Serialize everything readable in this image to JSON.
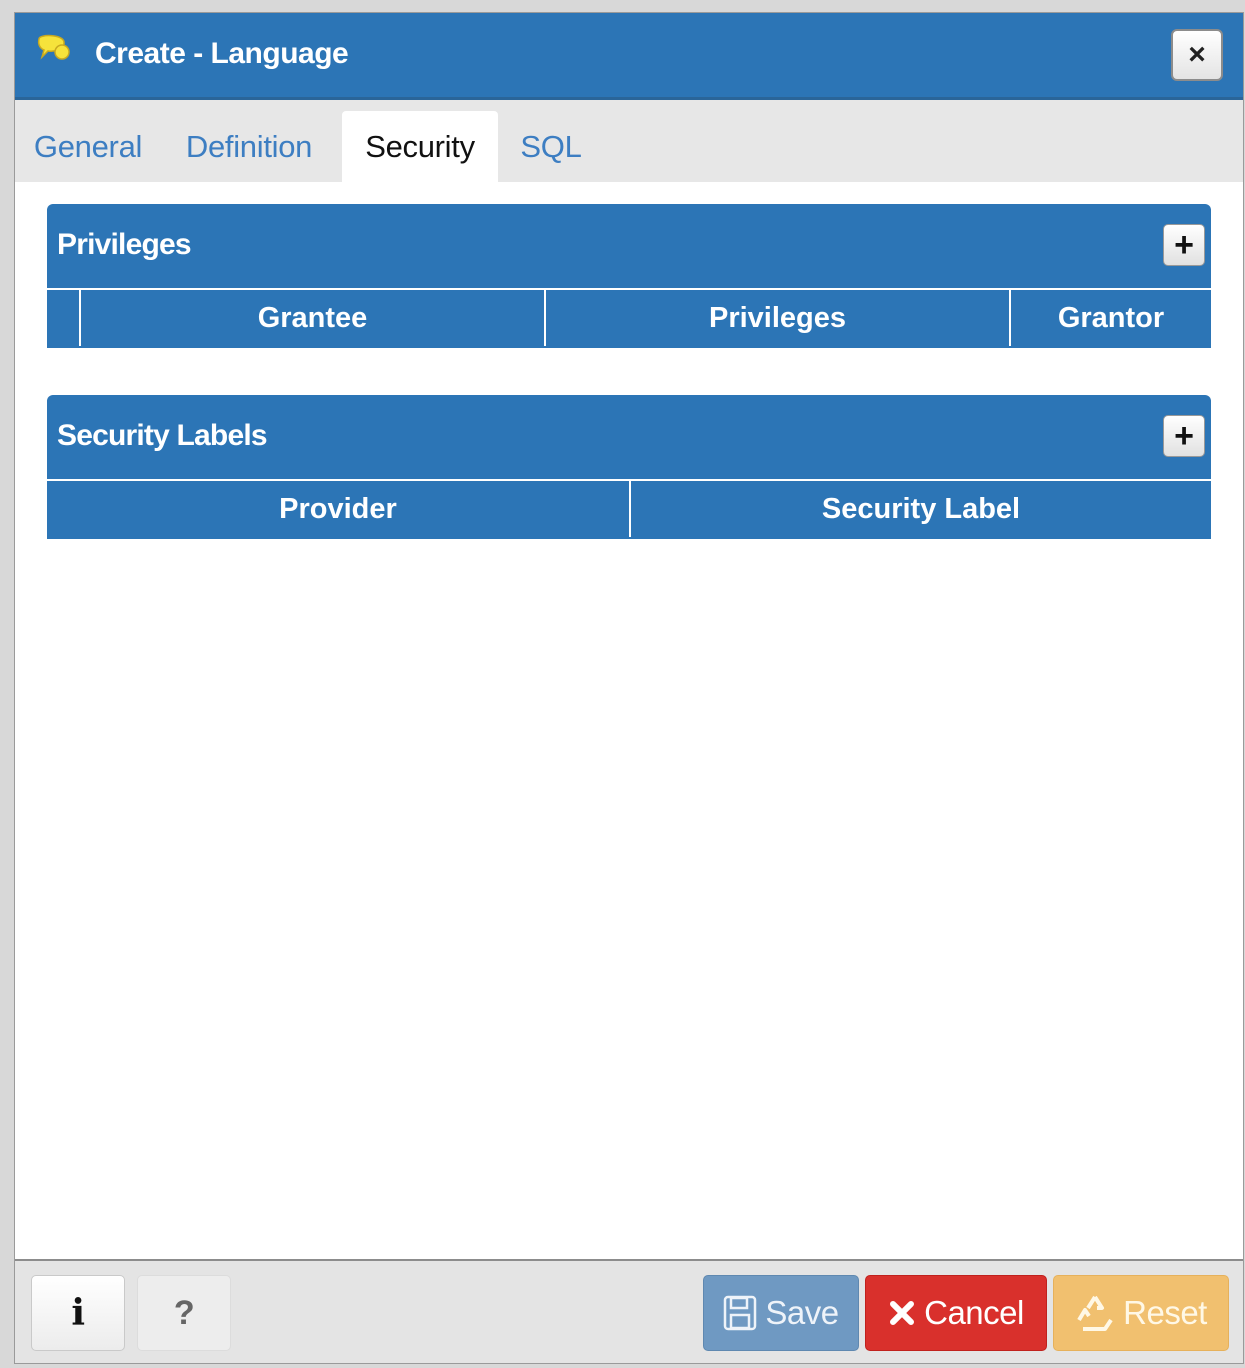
{
  "window": {
    "title": "Create - Language",
    "close_label": "×",
    "icon": "language-speech-bubble-icon"
  },
  "tabs": [
    {
      "label": "General",
      "active": false
    },
    {
      "label": "Definition",
      "active": false
    },
    {
      "label": "Security",
      "active": true
    },
    {
      "label": "SQL",
      "active": false
    }
  ],
  "privileges": {
    "title": "Privileges",
    "add_label": "+",
    "columns": [
      "Grantee",
      "Privileges",
      "Grantor"
    ]
  },
  "security_labels": {
    "title": "Security Labels",
    "add_label": "+",
    "columns": [
      "Provider",
      "Security Label"
    ]
  },
  "footer": {
    "info_label": "i",
    "help_label": "?",
    "save_label": "Save",
    "cancel_label": "Cancel",
    "reset_label": "Reset"
  },
  "colors": {
    "header_blue": "#2c75b6",
    "tab_link": "#3d7ec2",
    "save": "#6f99c2",
    "cancel": "#d9302c",
    "reset": "#f1c06f"
  }
}
